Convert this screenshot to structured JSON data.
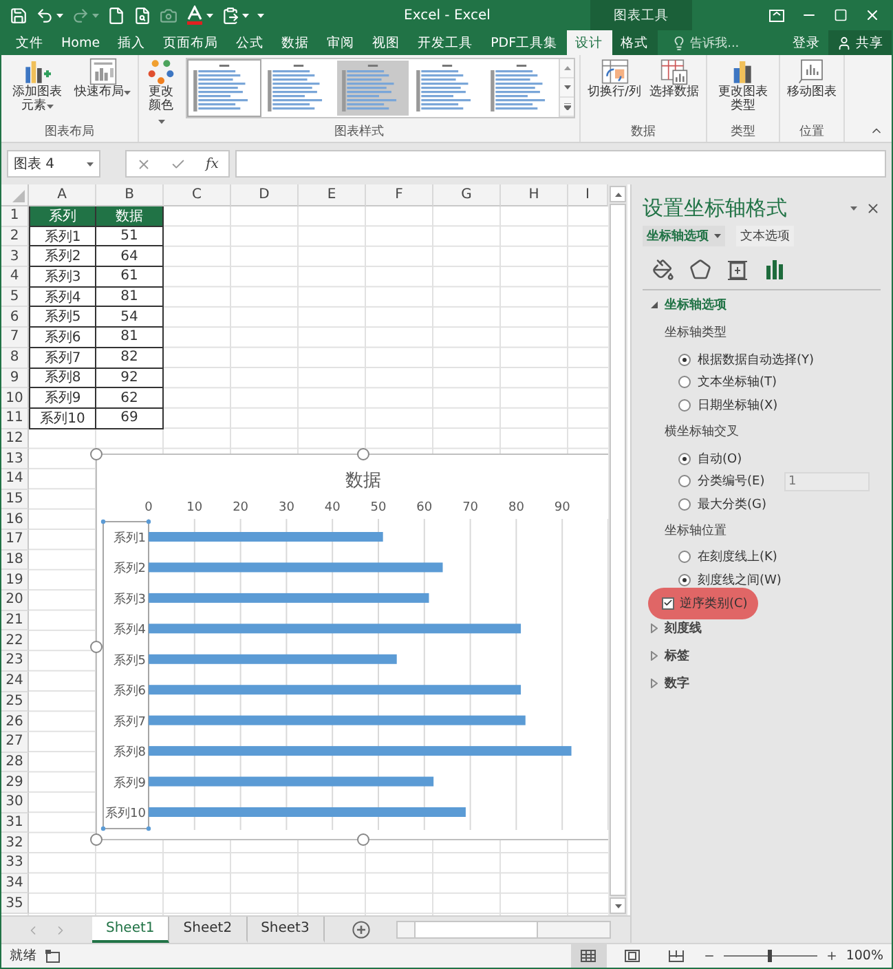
{
  "title_bar": {
    "title": "Excel - Excel",
    "context_label": "图表工具"
  },
  "ribbon_tabs": [
    {
      "label": "文件",
      "kind": "normal",
      "selected": false
    },
    {
      "label": "Home",
      "kind": "normal",
      "selected": false
    },
    {
      "label": "插入",
      "kind": "normal",
      "selected": false
    },
    {
      "label": "页面布局",
      "kind": "normal",
      "selected": false
    },
    {
      "label": "公式",
      "kind": "normal",
      "selected": false
    },
    {
      "label": "数据",
      "kind": "normal",
      "selected": false
    },
    {
      "label": "审阅",
      "kind": "normal",
      "selected": false
    },
    {
      "label": "视图",
      "kind": "normal",
      "selected": false
    },
    {
      "label": "开发工具",
      "kind": "normal",
      "selected": false
    },
    {
      "label": "PDF工具集",
      "kind": "normal",
      "selected": false
    },
    {
      "label": "设计",
      "kind": "context",
      "selected": true
    },
    {
      "label": "格式",
      "kind": "context",
      "selected": false
    }
  ],
  "tell_me": "告诉我...",
  "account": {
    "sign_in": "登录",
    "share": "共享"
  },
  "ribbon_groups": [
    {
      "label": "图表布局",
      "buttons": [
        {
          "label": "添加图表元素",
          "kind": "add-element",
          "dropdown": true
        },
        {
          "label": "快速布局",
          "kind": "quick-layout",
          "dropdown": true
        }
      ]
    },
    {
      "label": "图表样式",
      "buttons": [
        {
          "label": "更改颜色",
          "kind": "colors",
          "dropdown": true
        }
      ],
      "gallery": [
        {
          "kind": "light",
          "selected": true
        },
        {
          "kind": "light",
          "selected": false
        },
        {
          "kind": "shaded",
          "selected": false
        },
        {
          "kind": "light",
          "selected": false
        },
        {
          "kind": "light",
          "selected": false
        }
      ]
    },
    {
      "label": "数据",
      "buttons": [
        {
          "label": "切换行/列",
          "kind": "switch-row-column",
          "dropdown": false
        },
        {
          "label": "选择数据",
          "kind": "select-data",
          "dropdown": false
        }
      ]
    },
    {
      "label": "类型",
      "buttons": [
        {
          "label": "更改图表类型",
          "kind": "change-type",
          "dropdown": false
        }
      ]
    },
    {
      "label": "位置",
      "buttons": [
        {
          "label": "移动图表",
          "kind": "move-chart",
          "dropdown": false
        }
      ]
    }
  ],
  "formula_bar": {
    "name_box": "图表 4",
    "function_button": "fx"
  },
  "columns": [
    "A",
    "B",
    "C",
    "D",
    "E",
    "F",
    "G",
    "H",
    "I"
  ],
  "rows": [
    "1",
    "2",
    "3",
    "4",
    "5",
    "6",
    "7",
    "8",
    "9",
    "10",
    "11",
    "12",
    "13",
    "14",
    "15",
    "16",
    "17",
    "18",
    "19",
    "20",
    "21",
    "22",
    "23",
    "24",
    "25",
    "26",
    "27",
    "28",
    "29",
    "30",
    "31",
    "32",
    "33",
    "34",
    "35"
  ],
  "table": {
    "header": [
      "系列",
      "数据"
    ],
    "rows": [
      [
        "系列1",
        "51"
      ],
      [
        "系列2",
        "64"
      ],
      [
        "系列3",
        "61"
      ],
      [
        "系列4",
        "81"
      ],
      [
        "系列5",
        "54"
      ],
      [
        "系列6",
        "81"
      ],
      [
        "系列7",
        "82"
      ],
      [
        "系列8",
        "92"
      ],
      [
        "系列9",
        "62"
      ],
      [
        "系列10",
        "69"
      ]
    ]
  },
  "chart": {
    "chart_data": {
      "type": "bar",
      "orientation": "horizontal",
      "title": "数据",
      "categories": [
        "系列1",
        "系列2",
        "系列3",
        "系列4",
        "系列5",
        "系列6",
        "系列7",
        "系列8",
        "系列9",
        "系列10"
      ],
      "values": [
        51,
        64,
        61,
        81,
        54,
        81,
        82,
        92,
        62,
        69
      ],
      "xlim": [
        0,
        100
      ],
      "xticks": [
        0,
        10,
        20,
        30,
        40,
        50,
        60,
        70,
        80,
        90
      ],
      "grid": true
    }
  },
  "format_pane": {
    "title": "设置坐标轴格式",
    "tabs": [
      {
        "label": "坐标轴选项",
        "selected": true
      },
      {
        "label": "文本选项",
        "selected": false
      }
    ],
    "icon_tabs": [
      {
        "kind": "fill",
        "selected": false
      },
      {
        "kind": "effects",
        "selected": false
      },
      {
        "kind": "size",
        "selected": false
      },
      {
        "kind": "axis",
        "selected": true
      }
    ],
    "sections": [
      {
        "label": "坐标轴选项",
        "expanded": true,
        "groups": [
          {
            "label": "坐标轴类型",
            "options": [
              {
                "kind": "radio",
                "label": "根据数据自动选择(Y)",
                "selected": true
              },
              {
                "kind": "radio",
                "label": "文本坐标轴(T)",
                "selected": false
              },
              {
                "kind": "radio",
                "label": "日期坐标轴(X)",
                "selected": false
              }
            ]
          },
          {
            "label": "横坐标轴交叉",
            "options": [
              {
                "kind": "radio",
                "label": "自动(O)",
                "selected": true
              },
              {
                "kind": "radio",
                "label": "分类编号(E)",
                "selected": false,
                "value": "1"
              },
              {
                "kind": "radio",
                "label": "最大分类(G)",
                "selected": false
              }
            ]
          },
          {
            "label": "坐标轴位置",
            "options": [
              {
                "kind": "radio",
                "label": "在刻度线上(K)",
                "selected": false
              },
              {
                "kind": "radio",
                "label": "刻度线之间(W)",
                "selected": true
              },
              {
                "kind": "checkbox",
                "label": "逆序类别(C)",
                "checked": true,
                "highlighted": true
              }
            ]
          }
        ]
      },
      {
        "label": "刻度线",
        "expanded": false
      },
      {
        "label": "标签",
        "expanded": false
      },
      {
        "label": "数字",
        "expanded": false
      }
    ]
  },
  "sheet_tabs": [
    {
      "label": "Sheet1",
      "selected": true
    },
    {
      "label": "Sheet2",
      "selected": false
    },
    {
      "label": "Sheet3",
      "selected": false
    }
  ],
  "status_bar": {
    "text": "就绪",
    "views": [
      {
        "kind": "normal",
        "selected": true
      },
      {
        "kind": "page-layout",
        "selected": false
      },
      {
        "kind": "page-break",
        "selected": false
      }
    ],
    "zoom": {
      "level": 0.5
    },
    "zoom_text": "100%"
  }
}
